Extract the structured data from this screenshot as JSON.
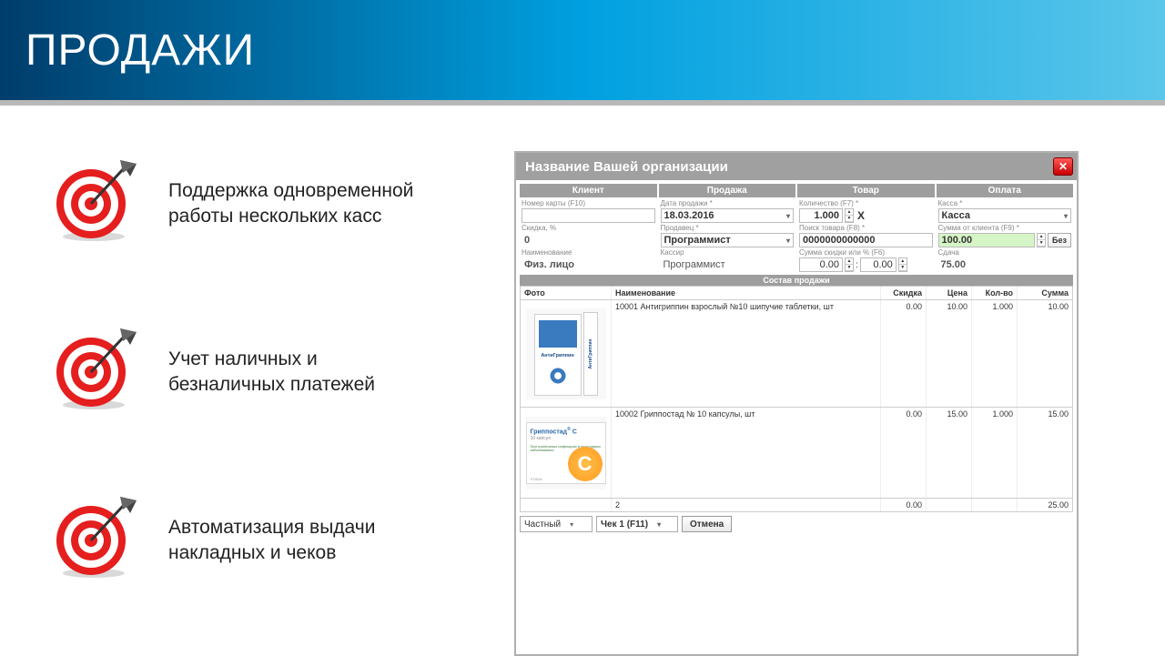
{
  "header": {
    "title": "ПРОДАЖИ"
  },
  "bullets": [
    "Поддержка одновременной работы нескольких касс",
    "Учет наличных и безналичных платежей",
    "Автоматизация выдачи накладных и чеков"
  ],
  "pos": {
    "title": "Название Вашей организации",
    "close": "✕",
    "panel_headers": {
      "client": "Клиент",
      "sale": "Продажа",
      "product": "Товар",
      "payment": "Оплата"
    },
    "labels": {
      "card_no": "Номер карты (F10)",
      "discount_pct": "Скидка, %",
      "name": "Наименование",
      "sale_date": "Дата продажи *",
      "seller": "Продавец *",
      "cashier": "Кассир",
      "qty": "Количество (F7) *",
      "search": "Поиск товара (F8) *",
      "disc_amount": "Сумма скидки или % (F6)",
      "cash_reg": "Касса *",
      "from_client": "Сумма от клиента (F9) *",
      "change": "Сдача"
    },
    "values": {
      "card_no": "",
      "discount_pct": "0",
      "name": "Физ. лицо",
      "sale_date": "18.03.2016",
      "seller": "Программист",
      "cashier": "Программист",
      "qty": "1.000",
      "x": "X",
      "search": "0000000000000",
      "disc_amount1": "0.00",
      "disc_amount2": "0.00",
      "cash_reg": "Касса",
      "from_client": "100.00",
      "bez": "Без",
      "change": "75.00"
    },
    "composition_header": "Состав продажи",
    "cols": {
      "photo": "Фото",
      "name": "Наименование",
      "disc": "Скидка",
      "price": "Цена",
      "qty": "Кол-во",
      "sum": "Сумма"
    },
    "items": [
      {
        "name": "10001 Антигриппин взрослый №10 шипучие таблетки, шт",
        "disc": "0.00",
        "price": "10.00",
        "qty": "1.000",
        "sum": "10.00",
        "img": "antigrippin"
      },
      {
        "name": "10002 Гриппостад № 10 капсулы, шт",
        "disc": "0.00",
        "price": "15.00",
        "qty": "1.000",
        "sum": "15.00",
        "img": "grippostad"
      }
    ],
    "totals": {
      "count": "2",
      "disc": "0.00",
      "sum": "25.00"
    },
    "bottom": {
      "type": "Частный",
      "receipt": "Чек 1 (F11)",
      "cancel": "Отмена"
    }
  }
}
